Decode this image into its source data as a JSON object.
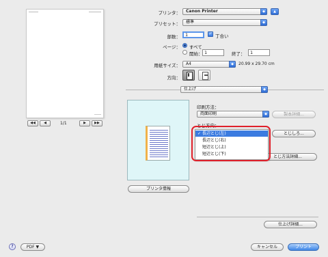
{
  "dialog": {
    "printer_label": "プリンタ：",
    "printer_value": "Canon Printer",
    "preset_label": "プリセット：",
    "preset_value": "標準",
    "copies_label": "部数：",
    "copies_value": "1",
    "collate_label": "丁合い",
    "pages_label": "ページ：",
    "pages_all": "すべて",
    "pages_from_label": "開始：",
    "pages_from_value": "1",
    "pages_to_label": "終了：",
    "pages_to_value": "1",
    "paper_size_label": "用紙サイズ：",
    "paper_size_value": "A4",
    "paper_size_dims": "20.99 x 29.70 cm",
    "orientation_label": "方向：",
    "panel_popup": "仕上げ",
    "print_method_label": "印刷方法：",
    "print_method_value": "両面印刷",
    "bookbinding_btn": "製本詳細...",
    "binding_location_label": "とじ方向：",
    "binding_btn": "とじしろ...",
    "binding_detail_btn": "とじ方法詳細...",
    "binding_options": [
      "長辺とじ(左)",
      "長辺とじ(右)",
      "短辺とじ(上)",
      "短辺とじ(下)"
    ],
    "binding_selected_index": 0,
    "finishing_detail_btn": "仕上げ詳細...",
    "printer_info_btn": "プリンタ情報",
    "page_indicator": "1/1",
    "nav_first": "◀◀",
    "nav_prev": "◀",
    "nav_next": "▶",
    "nav_last": "▶▶",
    "help": "?",
    "pdf_btn": "PDF ▼",
    "cancel_btn": "キャンセル",
    "print_btn": "プリント"
  },
  "colors": {
    "accent": "#3b7be0",
    "highlight_ring": "#e0202a",
    "preview_bg": "#dff6f8",
    "doc_edge": "#f0b24a",
    "doc_lines": "#6b78c9"
  },
  "icons": [
    "help-icon",
    "portrait-orientation-icon",
    "landscape-orientation-icon",
    "expand-icon"
  ]
}
